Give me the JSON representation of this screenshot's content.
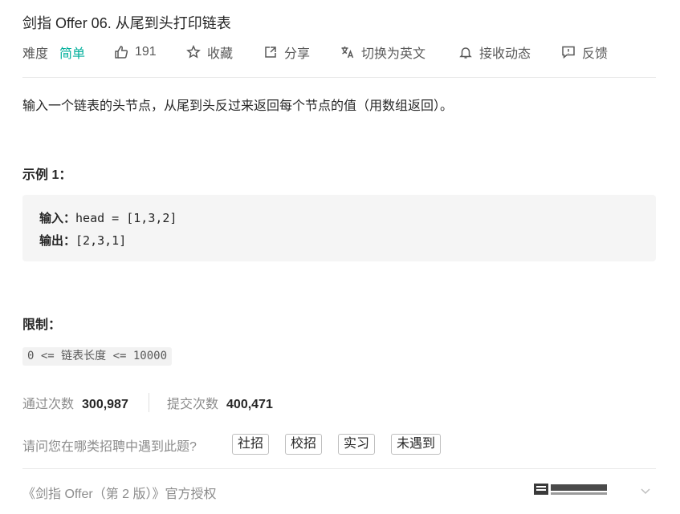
{
  "problem": {
    "title": "剑指 Offer 06. 从尾到头打印链表",
    "difficulty_label": "难度",
    "difficulty": "简单",
    "likes": "191",
    "favorite_label": "收藏",
    "share_label": "分享",
    "translate_label": "切换为英文",
    "notify_label": "接收动态",
    "feedback_label": "反馈",
    "description": "输入一个链表的头节点，从尾到头反过来返回每个节点的值（用数组返回）。",
    "example_heading": "示例 1：",
    "example": {
      "input_label": "输入：",
      "input_value": "head = [1,3,2]",
      "output_label": "输出：",
      "output_value": "[2,3,1]"
    },
    "limit_heading": "限制：",
    "constraint": "0 <= 链表长度 <= 10000"
  },
  "stats": {
    "accepted_label": "通过次数",
    "accepted_value": "300,987",
    "submitted_label": "提交次数",
    "submitted_value": "400,471"
  },
  "interview": {
    "question": "请问您在哪类招聘中遇到此题?",
    "tags": [
      "社招",
      "校招",
      "实习",
      "未遇到"
    ]
  },
  "footer": {
    "authorization": "《剑指 Offer（第 2 版）》官方授权",
    "publisher_logo_icon": "publisher-logo",
    "expand_icon": "chevron-down-icon"
  },
  "colors": {
    "easy": "#00af9b",
    "text": "#262626",
    "muted": "#8c8c8c"
  }
}
